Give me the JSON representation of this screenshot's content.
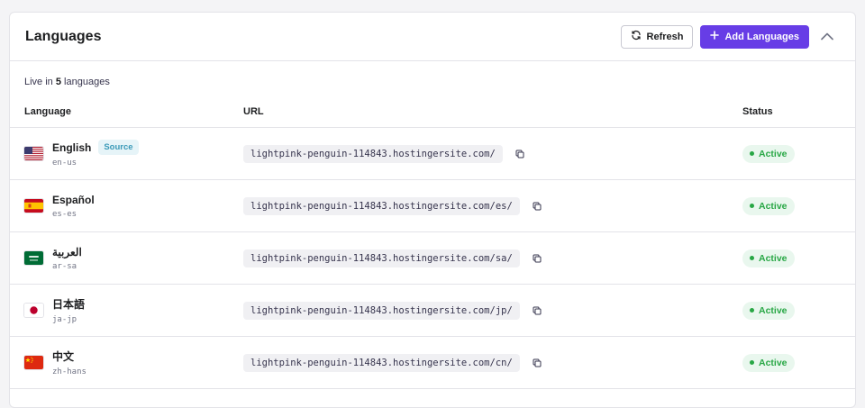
{
  "header": {
    "title": "Languages",
    "refresh_label": "Refresh",
    "add_label": "Add Languages"
  },
  "live": {
    "prefix": "Live in",
    "count": "5",
    "suffix": "languages"
  },
  "table": {
    "columns": [
      "Language",
      "URL",
      "Status"
    ],
    "rows": [
      {
        "name": "English",
        "code": "en-us",
        "badge": "Source",
        "url": "lightpink-penguin-114843.hostingersite.com/",
        "status": "Active",
        "flag": "us"
      },
      {
        "name": "Español",
        "code": "es-es",
        "url": "lightpink-penguin-114843.hostingersite.com/es/",
        "status": "Active",
        "flag": "es"
      },
      {
        "name": "العربية",
        "code": "ar-sa",
        "url": "lightpink-penguin-114843.hostingersite.com/sa/",
        "status": "Active",
        "flag": "sa"
      },
      {
        "name": "日本語",
        "code": "ja-jp",
        "url": "lightpink-penguin-114843.hostingersite.com/jp/",
        "status": "Active",
        "flag": "jp"
      },
      {
        "name": "中文",
        "code": "zh-hans",
        "url": "lightpink-penguin-114843.hostingersite.com/cn/",
        "status": "Active",
        "flag": "cn"
      }
    ]
  },
  "colors": {
    "accent": "#673de6",
    "active_bg": "#e9f7ee",
    "active_text": "#28a745",
    "source_bg": "#e6f4f8",
    "source_text": "#3b9ab8"
  }
}
